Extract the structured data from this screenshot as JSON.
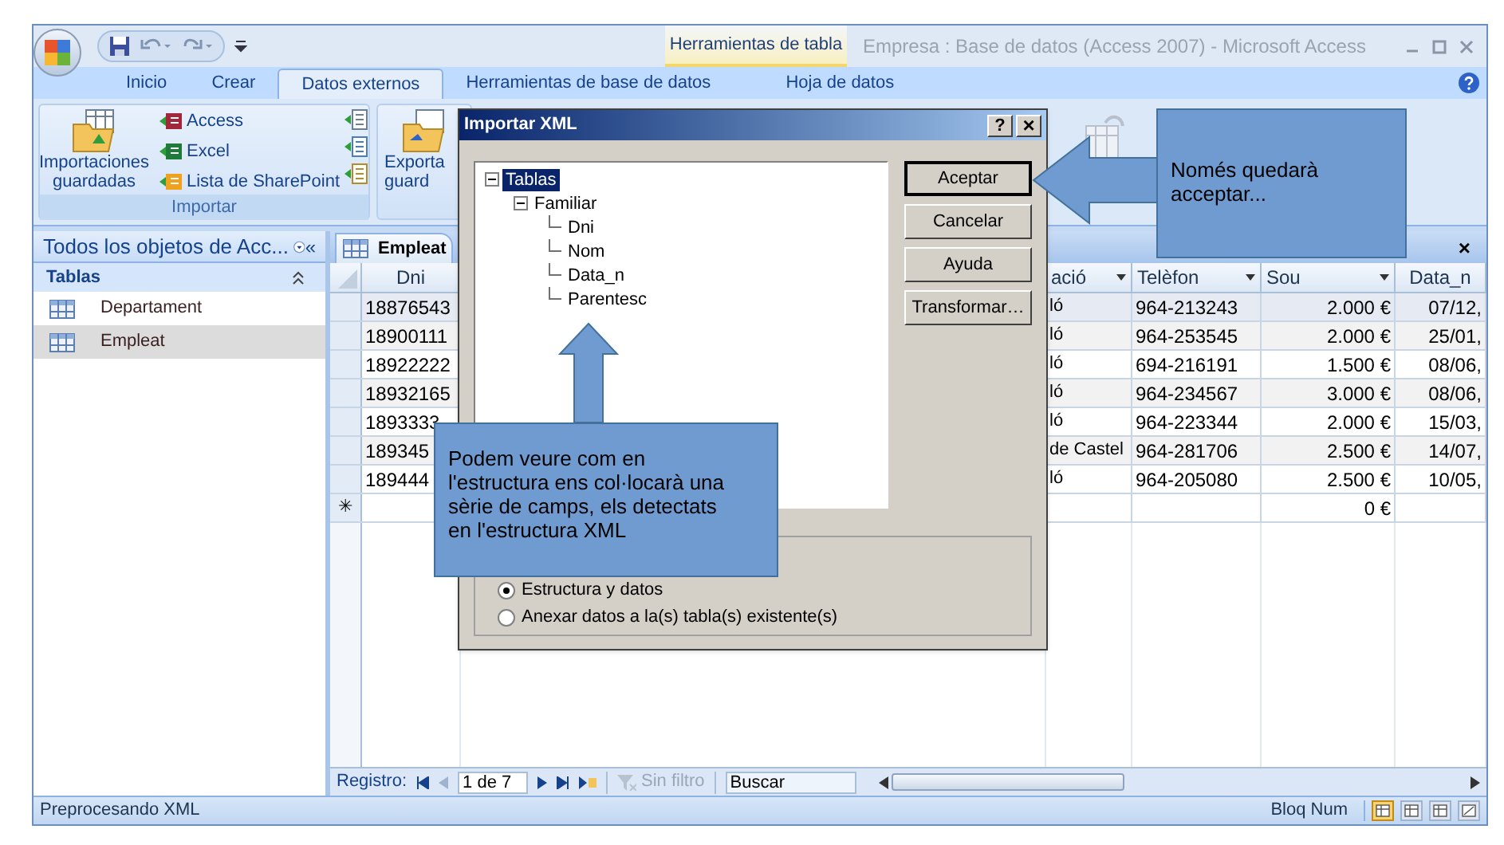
{
  "window": {
    "title": "Empresa : Base de datos (Access 2007) - Microsoft Access",
    "contextual_group": "Herramientas de tabla"
  },
  "ribbon_tabs": [
    {
      "label": "Inicio",
      "selected": false
    },
    {
      "label": "Crear",
      "selected": false
    },
    {
      "label": "Datos externos",
      "selected": true
    },
    {
      "label": "Herramientas de base de datos",
      "selected": false
    },
    {
      "label": "Hoja de datos",
      "selected": false
    }
  ],
  "ribbon": {
    "import_group": {
      "label": "Importar",
      "saved_imports": [
        "Importaciones",
        "guardadas"
      ],
      "sources": [
        "Access",
        "Excel",
        "Lista de SharePoint"
      ]
    },
    "export_fragment": [
      "Exporta",
      "guard"
    ]
  },
  "navigation_pane": {
    "title": "Todos los objetos de Acc...",
    "collapse": "«",
    "group": "Tablas",
    "items": [
      {
        "label": "Departament",
        "selected": false
      },
      {
        "label": "Empleat",
        "selected": true
      }
    ]
  },
  "document_tab": {
    "label": "Empleat",
    "close": "×"
  },
  "table": {
    "columns": [
      "Dni",
      "ació",
      "Telèfon",
      "Sou",
      "Data_n"
    ],
    "rows": [
      [
        "18876543",
        "ló",
        "964-213243",
        "2.000 €",
        "07/12,"
      ],
      [
        "18900111",
        "ló",
        "964-253545",
        "2.000 €",
        "25/01,"
      ],
      [
        "18922222",
        "ló",
        "694-216191",
        "1.500 €",
        "08/06,"
      ],
      [
        "18932165",
        "ló",
        "964-234567",
        "3.000 €",
        "08/06,"
      ],
      [
        "1893333",
        "ló",
        "964-223344",
        "2.000 €",
        "15/03,"
      ],
      [
        "189345",
        "de Castel",
        "964-281706",
        "2.500 €",
        "14/07,"
      ],
      [
        "189444",
        "ló",
        "964-205080",
        "2.500 €",
        "10/05,"
      ]
    ],
    "new_row": {
      "marker": "✳",
      "sou": "0 €"
    }
  },
  "record_navigator": {
    "label": "Registro:",
    "position": "1 de 7",
    "filter": {
      "label": "Sin filtro",
      "disabled": true
    },
    "search": "Buscar"
  },
  "status_bar": {
    "message": "Preprocesando XML",
    "indicator": "Bloq Num"
  },
  "dialog": {
    "title": "Importar XML",
    "help": "?",
    "close": "×",
    "tree": [
      {
        "label": "Tablas",
        "selected": true,
        "expanded": true,
        "children": [
          {
            "label": "Familiar",
            "selected": false,
            "expanded": true,
            "children": [
              {
                "label": "Dni",
                "selected": false
              },
              {
                "label": "Nom",
                "selected": false
              },
              {
                "label": "Data_n",
                "selected": false
              },
              {
                "label": "Parentesc",
                "selected": false
              }
            ]
          }
        ]
      }
    ],
    "buttons": [
      {
        "label": "Aceptar",
        "default": true
      },
      {
        "label": "Cancelar",
        "default": false
      },
      {
        "label": "Ayuda",
        "default": false
      },
      {
        "label": "Transformar…",
        "default": false
      }
    ],
    "options": [
      {
        "label": "Estructura y datos",
        "selected": true
      },
      {
        "label": "Anexar datos a la(s) tabla(s) existente(s)",
        "selected": false
      }
    ]
  },
  "callouts": [
    {
      "kind": "upward",
      "text": "Podem veure com en l'estructura ens col·locarà una sèrie de camps, els detectats en l'estructura XML"
    },
    {
      "kind": "leftward",
      "text": "Només quedarà acceptar..."
    }
  ]
}
